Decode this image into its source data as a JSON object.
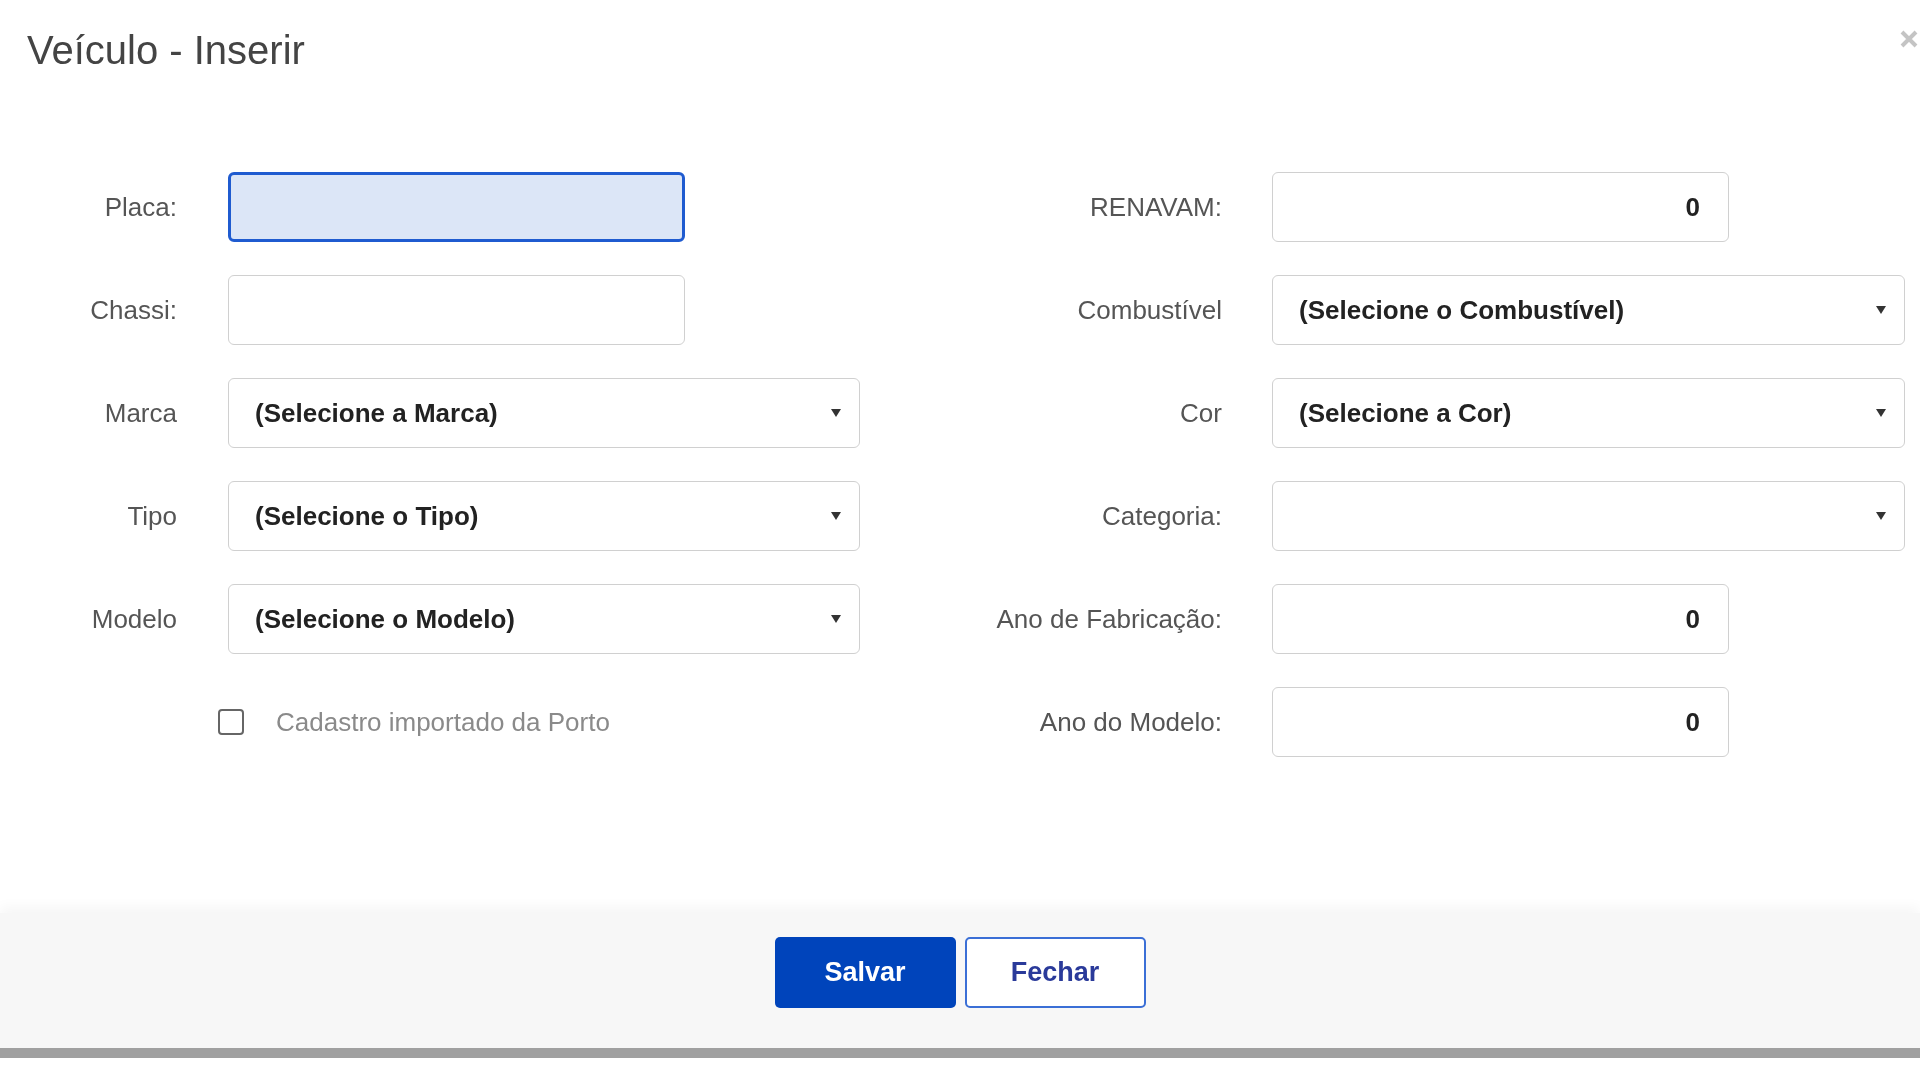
{
  "dialog": {
    "title": "Veículo - Inserir"
  },
  "left_fields": [
    {
      "kind": "text",
      "label": "Placa:",
      "focused": true
    },
    {
      "kind": "text",
      "label": "Chassi:",
      "focused": false
    },
    {
      "kind": "select",
      "label": "Marca",
      "value": "(Selecione a Marca)"
    },
    {
      "kind": "select",
      "label": "Tipo",
      "value": "(Selecione o Tipo)"
    },
    {
      "kind": "select",
      "label": "Modelo",
      "value": "(Selecione o Modelo)"
    },
    {
      "kind": "checkbox",
      "label": "Cadastro importado da Porto",
      "checked": false
    }
  ],
  "right_fields": [
    {
      "kind": "text",
      "label": "RENAVAM:",
      "value": "0",
      "focused": false
    },
    {
      "kind": "select",
      "label": "Combustível",
      "value": "(Selecione o Combustível)"
    },
    {
      "kind": "select",
      "label": "Cor",
      "value": "(Selecione a Cor)"
    },
    {
      "kind": "select",
      "label": "Categoria:"
    },
    {
      "kind": "text",
      "label": "Ano de Fabricação:",
      "value": "0",
      "focused": false
    },
    {
      "kind": "text",
      "label": "Ano do Modelo:",
      "value": "0",
      "focused": false
    }
  ],
  "buttons": [
    {
      "label": "Salvar",
      "primary": true
    },
    {
      "label": "Fechar",
      "primary": false
    }
  ]
}
